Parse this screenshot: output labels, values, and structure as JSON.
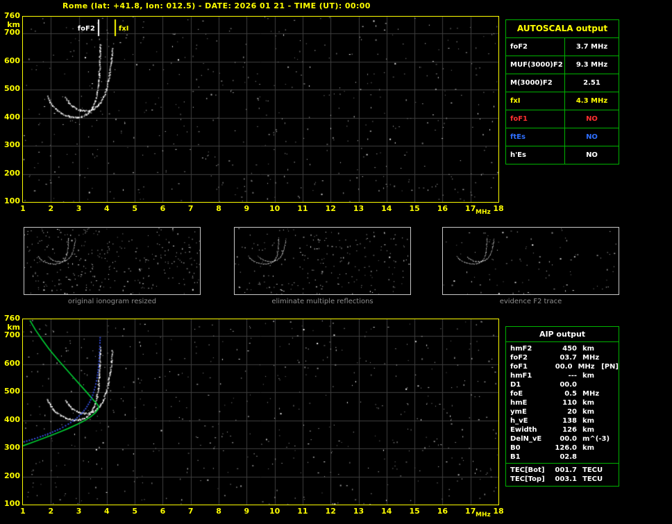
{
  "title": "Rome (lat: +41.8, lon: 012.5) - DATE: 2026 01 21 - TIME (UT): 00:00",
  "colors": {
    "yellow": "#ffff00",
    "green": "#00b400",
    "red": "#ff3030",
    "blue": "#2f6fff",
    "grid": "#3f3f3f",
    "caption_gray": "#8f8f8f",
    "thumb_border": "#c8c8c8",
    "trace_white": "#ffffff",
    "profile_green": "#00cc33",
    "hprime_blue": "#3a55ee"
  },
  "autoscala_table": {
    "header": "AUTOSCALA output",
    "rows": [
      {
        "label": "foF2",
        "value": "3.7 MHz",
        "color": "#ffffff"
      },
      {
        "label": "MUF(3000)F2",
        "value": "9.3 MHz",
        "color": "#ffffff"
      },
      {
        "label": "M(3000)F2",
        "value": "2.51",
        "color": "#ffffff"
      },
      {
        "label": "fxI",
        "value": "4.3 MHz",
        "color": "#ffff00"
      },
      {
        "label": "foF1",
        "value": "NO",
        "color": "#ff3030"
      },
      {
        "label": "ftEs",
        "value": "NO",
        "color": "#2f6fff"
      },
      {
        "label": "h'Es",
        "value": "NO",
        "color": "#ffffff"
      }
    ]
  },
  "thumbnails": [
    {
      "caption": "original ionogram resized"
    },
    {
      "caption": "eliminate multiple reflections"
    },
    {
      "caption": "evidence F2 trace"
    }
  ],
  "aip_table": {
    "header": "AIP output",
    "rows": [
      {
        "label": "hmF2",
        "value": "450",
        "unit": "km",
        "extra": ""
      },
      {
        "label": "foF2",
        "value": "03.7",
        "unit": "MHz",
        "extra": ""
      },
      {
        "label": "foF1",
        "value": "00.0",
        "unit": "MHz",
        "extra": "[PN]"
      },
      {
        "label": "hmF1",
        "value": "---",
        "unit": "km",
        "extra": ""
      },
      {
        "label": "D1",
        "value": "00.0",
        "unit": "",
        "extra": ""
      },
      {
        "label": "foE",
        "value": "0.5",
        "unit": "MHz",
        "extra": ""
      },
      {
        "label": "hmE",
        "value": "110",
        "unit": "km",
        "extra": ""
      },
      {
        "label": "ymE",
        "value": "20",
        "unit": "km",
        "extra": ""
      },
      {
        "label": "h_vE",
        "value": "138",
        "unit": "km",
        "extra": ""
      },
      {
        "label": "Ewidth",
        "value": "126",
        "unit": "km",
        "extra": ""
      },
      {
        "label": "DelN_vE",
        "value": "00.0",
        "unit": "m^(-3)",
        "extra": ""
      },
      {
        "label": "B0",
        "value": "126.0",
        "unit": "km",
        "extra": ""
      },
      {
        "label": "B1",
        "value": "02.8",
        "unit": "",
        "extra": ""
      }
    ],
    "tec_rows": [
      {
        "label": "TEC[Bot]",
        "value": "001.7",
        "unit": "TECU"
      },
      {
        "label": "TEC[Top]",
        "value": "003.1",
        "unit": "TECU"
      }
    ]
  },
  "chart_data": [
    {
      "id": "main_ionogram",
      "type": "scatter",
      "title": "",
      "xlabel": "MHz",
      "ylabel": "km",
      "xlim": [
        1,
        18
      ],
      "ylim": [
        100,
        760
      ],
      "xticks": [
        1,
        2,
        3,
        4,
        5,
        6,
        7,
        8,
        9,
        10,
        11,
        12,
        13,
        14,
        15,
        16,
        17,
        18
      ],
      "yticks": [
        760,
        700,
        600,
        500,
        400,
        300,
        200,
        100
      ],
      "grid": true,
      "markers": [
        {
          "label": "foF2",
          "freq": 3.7,
          "color": "#ffffff"
        },
        {
          "label": "fxI",
          "freq": 4.3,
          "color": "#ffff00"
        }
      ],
      "traces": [
        {
          "name": "F2-ordinary-trace",
          "color": "#ffffff",
          "points": [
            [
              1.85,
              478
            ],
            [
              1.95,
              458
            ],
            [
              2.05,
              444
            ],
            [
              2.2,
              429
            ],
            [
              2.35,
              419
            ],
            [
              2.5,
              411
            ],
            [
              2.65,
              406
            ],
            [
              2.8,
              403
            ],
            [
              2.95,
              403
            ],
            [
              3.1,
              406
            ],
            [
              3.25,
              413
            ],
            [
              3.38,
              424
            ],
            [
              3.48,
              439
            ],
            [
              3.56,
              459
            ],
            [
              3.63,
              486
            ],
            [
              3.68,
              518
            ],
            [
              3.71,
              556
            ],
            [
              3.73,
              598
            ],
            [
              3.74,
              640
            ],
            [
              3.745,
              660
            ]
          ]
        },
        {
          "name": "F2-extraordinary-trace",
          "color": "#ffffff",
          "points": [
            [
              2.5,
              474
            ],
            [
              2.62,
              456
            ],
            [
              2.75,
              443
            ],
            [
              2.9,
              433
            ],
            [
              3.05,
              428
            ],
            [
              3.2,
              426
            ],
            [
              3.35,
              428
            ],
            [
              3.5,
              433
            ],
            [
              3.63,
              442
            ],
            [
              3.76,
              456
            ],
            [
              3.87,
              476
            ],
            [
              3.96,
              502
            ],
            [
              4.04,
              534
            ],
            [
              4.1,
              572
            ],
            [
              4.15,
              612
            ],
            [
              4.18,
              650
            ]
          ]
        }
      ],
      "noise": {
        "count": 540,
        "seed": 11
      }
    },
    {
      "id": "profile_ionogram",
      "type": "scatter",
      "title": "",
      "xlabel": "MHz",
      "ylabel": "km",
      "xlim": [
        1,
        18
      ],
      "ylim": [
        100,
        760
      ],
      "xticks": [
        1,
        2,
        3,
        4,
        5,
        6,
        7,
        8,
        9,
        10,
        11,
        12,
        13,
        14,
        15,
        16,
        17,
        18
      ],
      "yticks": [
        760,
        700,
        600,
        500,
        400,
        300,
        200,
        100
      ],
      "grid": true,
      "trace_source": "main_ionogram",
      "curves": [
        {
          "name": "electron-density-profile",
          "color": "#00cc33",
          "style": "line",
          "points": [
            [
              1.25,
              756
            ],
            [
              1.45,
              722
            ],
            [
              1.7,
              686
            ],
            [
              1.95,
              652
            ],
            [
              2.25,
              616
            ],
            [
              2.55,
              582
            ],
            [
              2.85,
              548
            ],
            [
              3.12,
              518
            ],
            [
              3.35,
              492
            ],
            [
              3.53,
              471
            ],
            [
              3.65,
              458
            ],
            [
              3.71,
              450
            ],
            [
              3.69,
              440
            ],
            [
              3.6,
              428
            ],
            [
              3.44,
              414
            ],
            [
              3.22,
              400
            ],
            [
              2.95,
              386
            ],
            [
              2.62,
              371
            ],
            [
              2.28,
              357
            ],
            [
              1.95,
              344
            ],
            [
              1.6,
              331
            ],
            [
              1.3,
              320
            ],
            [
              1.05,
              311
            ],
            [
              1.0,
              309
            ]
          ]
        },
        {
          "name": "reconstructed-hprime-trace",
          "color": "#3a55ee",
          "style": "dots",
          "points": [
            [
              1.02,
              326
            ],
            [
              1.3,
              334
            ],
            [
              1.6,
              344
            ],
            [
              1.95,
              357
            ],
            [
              2.3,
              372
            ],
            [
              2.6,
              389
            ],
            [
              2.85,
              406
            ],
            [
              3.05,
              424
            ],
            [
              3.22,
              444
            ],
            [
              3.36,
              467
            ],
            [
              3.47,
              492
            ],
            [
              3.56,
              521
            ],
            [
              3.63,
              554
            ],
            [
              3.68,
              592
            ],
            [
              3.71,
              634
            ],
            [
              3.73,
              678
            ],
            [
              3.74,
              706
            ]
          ]
        }
      ],
      "noise": {
        "count": 540,
        "seed": 23
      }
    },
    {
      "id": "thumb_original",
      "type": "scatter",
      "xlim": [
        1,
        12
      ],
      "ylim": [
        100,
        760
      ],
      "grid": false,
      "trace_source": "main_ionogram",
      "noise": {
        "count": 300,
        "seed": 31
      }
    },
    {
      "id": "thumb_filtered",
      "type": "scatter",
      "xlim": [
        1,
        12
      ],
      "ylim": [
        100,
        760
      ],
      "grid": false,
      "trace_source": "main_ionogram",
      "noise": {
        "count": 215,
        "seed": 41
      }
    },
    {
      "id": "thumb_evidence",
      "type": "scatter",
      "xlim": [
        1,
        12
      ],
      "ylim": [
        100,
        760
      ],
      "grid": false,
      "trace_source": "main_ionogram",
      "noise": {
        "count": 95,
        "seed": 51
      }
    }
  ]
}
